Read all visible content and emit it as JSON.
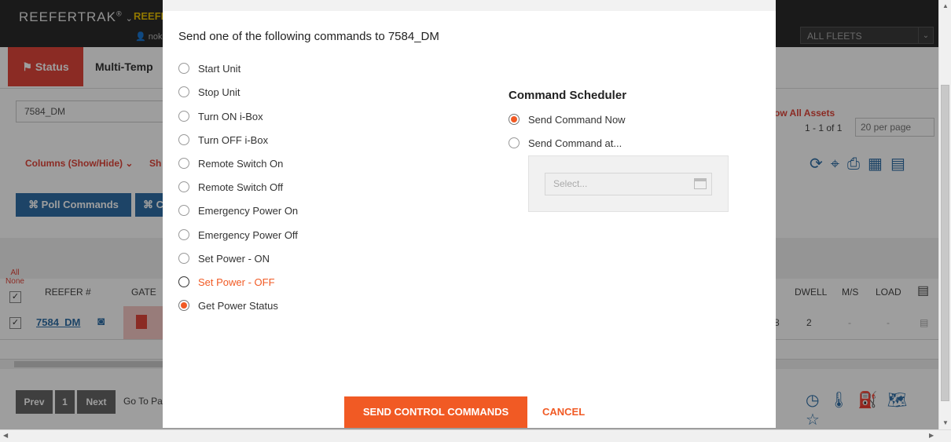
{
  "background": {
    "app_title": "REEFERTRAK",
    "app_title_mark": "®",
    "app_title_partial": "REEFE",
    "user_partial": "noki",
    "fleet_selector": "ALL FLEETS",
    "tabs": {
      "status": "Status",
      "multi_temp": "Multi-Temp"
    },
    "search_value": "7584_DM",
    "show_all_partial": "ow All Assets",
    "page_count": "1 - 1 of 1",
    "per_page": "20 per page",
    "columns_toggle": "Columns (Show/Hide)",
    "columns_toggle_partial": "Sh",
    "poll_commands": "⌘ Poll Commands",
    "poll_commands_partial": "⌘ C",
    "table": {
      "all": "All",
      "none": "None",
      "headers": {
        "reefer": "REEFER #",
        "gate": "GATE",
        "dwell": "DWELL",
        "ms": "M/S",
        "load": "LOAD"
      },
      "row": {
        "reefer": "7584_DM",
        "dwell": "2",
        "ms": "-",
        "load": "-",
        "partial_digit": "8"
      }
    },
    "pager": {
      "prev": "Prev",
      "page": "1",
      "next": "Next",
      "goto_partial": "Go To Pa"
    }
  },
  "modal": {
    "title": "Send one of the following commands to 7584_DM",
    "commands": [
      {
        "label": "Start Unit",
        "selected": false
      },
      {
        "label": "Stop Unit",
        "selected": false
      },
      {
        "label": "Turn ON i-Box",
        "selected": false
      },
      {
        "label": "Turn OFF i-Box",
        "selected": false
      },
      {
        "label": "Remote Switch On",
        "selected": false
      },
      {
        "label": "Remote Switch Off",
        "selected": false
      },
      {
        "label": "Emergency Power On",
        "selected": false
      },
      {
        "label": "Emergency Power Off",
        "selected": false
      },
      {
        "label": "Set Power - ON",
        "selected": false
      },
      {
        "label": "Set Power - OFF",
        "selected": false,
        "hover": true
      },
      {
        "label": "Get Power Status",
        "selected": true
      }
    ],
    "scheduler": {
      "title": "Command Scheduler",
      "send_now": "Send Command Now",
      "send_now_selected": true,
      "send_at": "Send Command at...",
      "date_placeholder": "Select..."
    },
    "send_button": "SEND CONTROL COMMANDS",
    "cancel": "CANCEL"
  },
  "colors": {
    "accent": "#f15a24",
    "status_tab": "#e0463a",
    "primary_blue": "#2f6fa6"
  }
}
